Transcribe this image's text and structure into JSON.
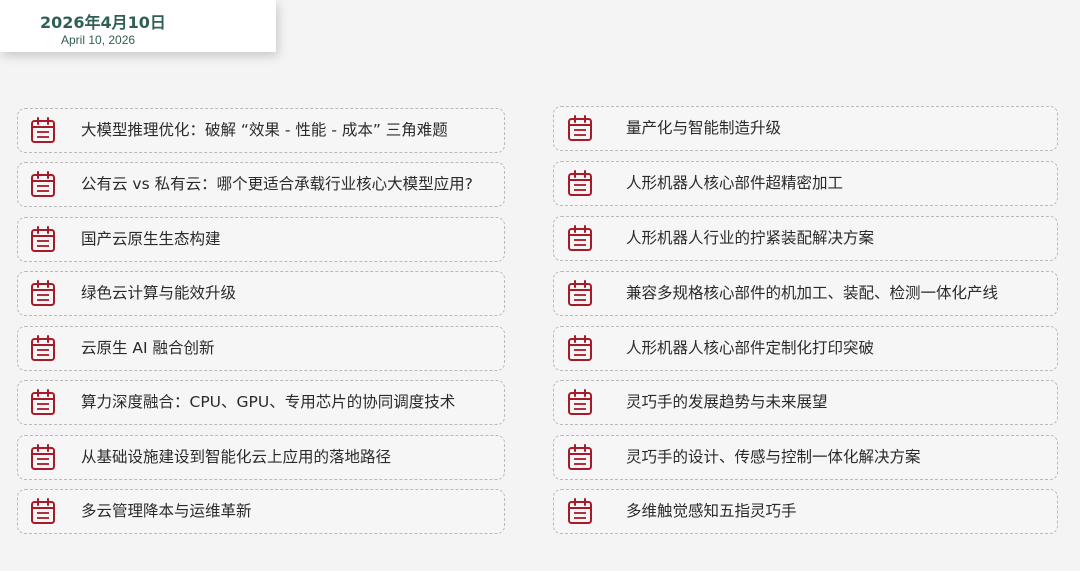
{
  "header": {
    "date_cn": "2026年4月10日",
    "date_en": "April 10, 2026"
  },
  "colors": {
    "accent": "#a61b29",
    "date_text": "#2f5f56",
    "border": "#b9b9b9"
  },
  "icon": "calendar-icon",
  "left_items": [
    {
      "label": "大模型推理优化：破解 “效果 - 性能 - 成本” 三角难题"
    },
    {
      "label": "公有云 vs 私有云：哪个更适合承载行业核心大模型应用?"
    },
    {
      "label": " 国产云原生生态构建"
    },
    {
      "label": "绿色云计算与能效升级"
    },
    {
      "label": " 云原生 AI 融合创新"
    },
    {
      "label": "算力深度融合：CPU、GPU、专用芯片的协同调度技术"
    },
    {
      "label": "从基础设施建设到智能化云上应用的落地路径"
    },
    {
      "label": "多云管理降本与运维革新"
    }
  ],
  "right_items": [
    {
      "label": "量产化与智能制造升级"
    },
    {
      "label": "人形机器人核心部件超精密加工"
    },
    {
      "label": "人形机器人行业的拧紧装配解决方案"
    },
    {
      "label": "兼容多规格核心部件的机加工、装配、检测一体化产线"
    },
    {
      "label": "人形机器人核心部件定制化打印突破"
    },
    {
      "label": "灵巧手的发展趋势与未来展望"
    },
    {
      "label": "灵巧手的设计、传感与控制一体化解决方案"
    },
    {
      "label": "多维触觉感知五指灵巧手"
    }
  ]
}
